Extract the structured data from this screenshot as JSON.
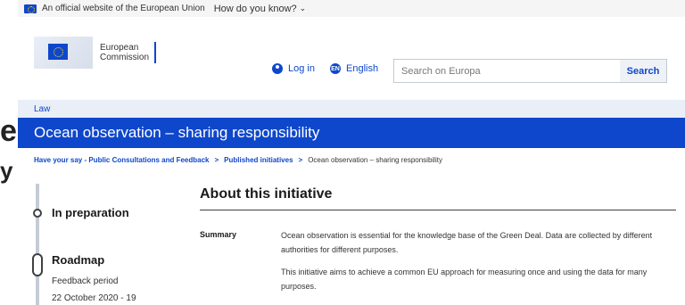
{
  "eu_banner": {
    "official_text": "An official website of the European Union",
    "how_text": "How do you know?"
  },
  "header": {
    "logo_text_line1": "European",
    "logo_text_line2": "Commission",
    "login_label": "Log in",
    "language_code": "EN",
    "language_label": "English",
    "search_placeholder": "Search on Europa",
    "search_button": "Search"
  },
  "section_label": "Law",
  "page_title": "Ocean observation – sharing responsibility",
  "breadcrumb": {
    "item1": "Have your say - Public Consultations and Feedback",
    "item2": "Published initiatives",
    "current": "Ocean observation – sharing responsibility"
  },
  "timeline": {
    "stage1": "In preparation",
    "stage2": "Roadmap",
    "stage2_sub": "Feedback period",
    "stage2_dates": "22 October 2020 - 19"
  },
  "about": {
    "heading": "About this initiative",
    "summary_label": "Summary",
    "paragraph1": "Ocean observation is essential for the knowledge base of the Green Deal. Data are collected by different authorities for different purposes.",
    "paragraph2": "This initiative aims to achieve a common EU approach for measuring once and using the data for many purposes."
  },
  "background_page": {
    "glyph1": "e",
    "glyph2": "y"
  },
  "colors": {
    "brand_blue": "#0e47cb",
    "law_bar": "#e9eef7",
    "banner_bg": "#f5f5f5"
  }
}
